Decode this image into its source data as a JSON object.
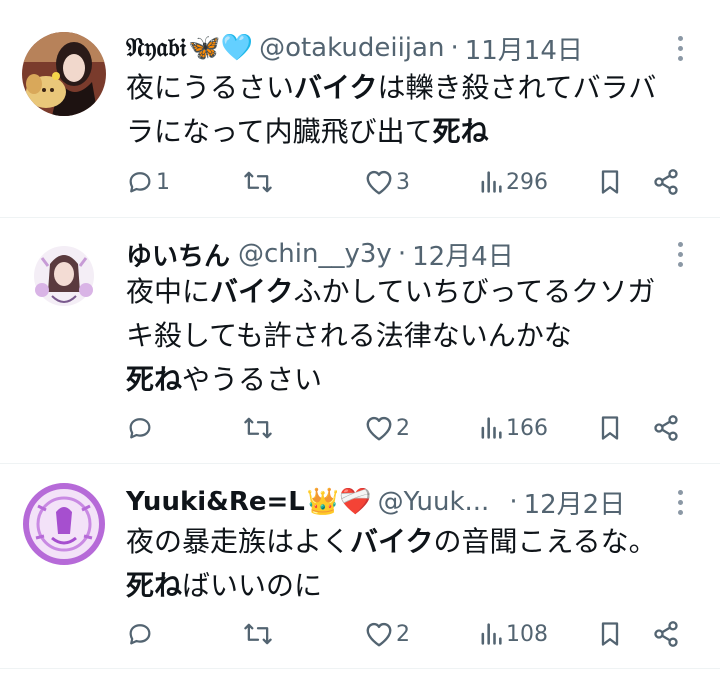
{
  "tweets": [
    {
      "name": "𝔑𝔶𝔞𝔟𝔦",
      "emoji": "🦋🩵",
      "handle": "@otakudeiijan",
      "separator": "·",
      "date": "11月14日",
      "lines": [
        [
          {
            "t": "夜にうるさい"
          },
          {
            "t": "バイク",
            "b": true
          },
          {
            "t": "は轢き殺されてバラバ"
          }
        ],
        [
          {
            "t": "ラになって内臓飛び出て"
          },
          {
            "t": "死ね",
            "b": true
          }
        ]
      ],
      "replies": "1",
      "retweets": "",
      "likes": "3",
      "views": "296"
    },
    {
      "name": "ゆいちん",
      "emoji": "",
      "handle": "@chin__y3y",
      "separator": "·",
      "date": "12月4日",
      "lines": [
        [
          {
            "t": "夜中に"
          },
          {
            "t": "バイク",
            "b": true
          },
          {
            "t": "ふかしていちびってるクソガ"
          }
        ],
        [
          {
            "t": "キ殺しても許される法律ないんかな"
          }
        ],
        [
          {
            "t": "死ね",
            "b": true
          },
          {
            "t": "やうるさい"
          }
        ]
      ],
      "replies": "",
      "retweets": "",
      "likes": "2",
      "views": "166"
    },
    {
      "name": "Yuuki&Re=L",
      "emoji": "👑❤️‍🩹",
      "handle": "@Yuuk...",
      "separator": "·",
      "date": "12月2日",
      "lines": [
        [
          {
            "t": "夜の暴走族はよく"
          },
          {
            "t": "バイク",
            "b": true
          },
          {
            "t": "の音聞こえるな。"
          }
        ],
        [
          {
            "t": "死ね",
            "b": true
          },
          {
            "t": "ばいいのに"
          }
        ]
      ],
      "replies": "",
      "retweets": "",
      "likes": "2",
      "views": "108"
    }
  ],
  "icons": {
    "reply": "reply-icon",
    "retweet": "retweet-icon",
    "like": "heart-icon",
    "views": "views-icon",
    "bookmark": "bookmark-icon",
    "share": "share-icon",
    "more": "more-icon"
  },
  "colors": {
    "text": "#0f1419",
    "secondary": "#536471",
    "divider": "#eff3f4"
  }
}
